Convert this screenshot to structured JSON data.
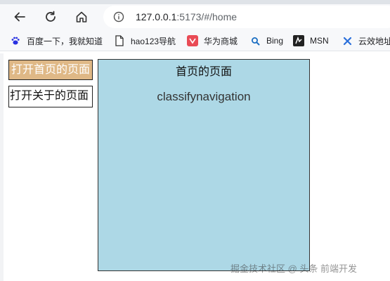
{
  "browser": {
    "url_host": "127.0.0.1",
    "url_rest": ":5173/#/home",
    "icons": [
      "back-arrow-icon",
      "reload-icon",
      "home-icon",
      "info-icon"
    ]
  },
  "bookmarks": [
    {
      "label": "百度一下，我就知道",
      "icon": "baidu-paw-icon"
    },
    {
      "label": "hao123导航",
      "icon": "page-icon"
    },
    {
      "label": "华为商城",
      "icon": "huawei-mall-icon"
    },
    {
      "label": "Bing",
      "icon": "bing-search-icon"
    },
    {
      "label": "MSN",
      "icon": "msn-icon"
    },
    {
      "label": "云效地址",
      "icon": "yunxiao-icon"
    }
  ],
  "page": {
    "nav": {
      "home_link": "打开首页的页面",
      "about_link": "打开关于的页面"
    },
    "view": {
      "title": "首页的页面",
      "subtitle": "classifynavigation"
    },
    "watermark": "掘金技术社区 @ 头条 前端开发"
  },
  "colors": {
    "active_link_bg": "#dfb886",
    "panel_bg": "#add8e6"
  }
}
